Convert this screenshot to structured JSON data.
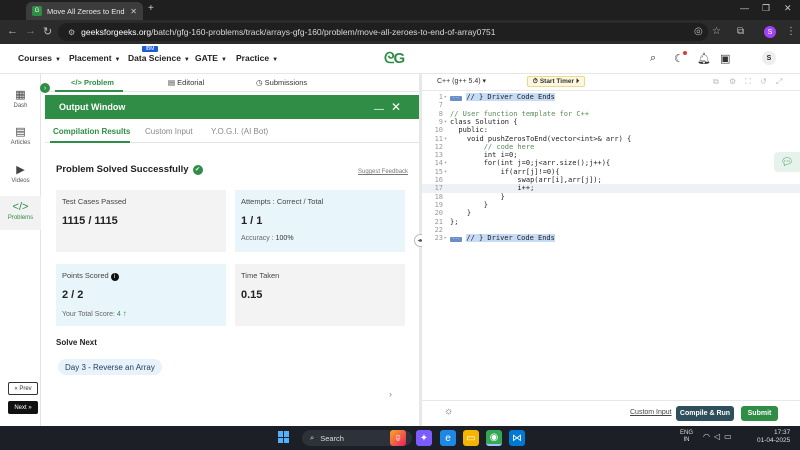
{
  "browser": {
    "tab_title": "Move All Zeroes to End | Practi",
    "tab_close": "✕",
    "new_tab": "+",
    "url_host": "geeksforgeeks.org",
    "url_path": "/batch/gfg-160-problems/track/arrays-gfg-160/problem/move-all-zeroes-to-end-of-array0751",
    "profile_initial": "S"
  },
  "header": {
    "menus": [
      "Courses",
      "Placement",
      "Data Science",
      "GATE",
      "Practice"
    ],
    "ibm_badge": "IBM",
    "avatar_initial": "S"
  },
  "sidebar": {
    "items": [
      {
        "label": "Dash",
        "icon": "grid-icon"
      },
      {
        "label": "Articles",
        "icon": "book-icon"
      },
      {
        "label": "Videos",
        "icon": "play-icon"
      },
      {
        "label": "Problems",
        "icon": "code-icon"
      }
    ],
    "prev": "« Prev",
    "next": "Next »"
  },
  "problem_tabs": {
    "problem": "Problem",
    "editorial": "Editorial",
    "submissions": "Submissions"
  },
  "output": {
    "title": "Output Window",
    "tabs": [
      "Compilation Results",
      "Custom Input",
      "Y.O.G.I. (AI Bot)"
    ],
    "status": "Problem Solved Successfully",
    "feedback": "Suggest Feedback",
    "cards": {
      "tests_label": "Test Cases Passed",
      "tests_value": "1115 / 1115",
      "attempts_label": "Attempts : Correct / Total",
      "attempts_value": "1 / 1",
      "accuracy_label": "Accuracy :",
      "accuracy_value": "100%",
      "points_label": "Points Scored",
      "points_value": "2 / 2",
      "total_score_label": "Your Total Score:",
      "total_score_value": "4",
      "time_label": "Time Taken",
      "time_value": "0.15"
    },
    "solve_next": "Solve Next",
    "next_problem": "Day 3 - Reverse an Array"
  },
  "editor": {
    "language": "C++ (g++ 5.4)",
    "timer": "Start Timer",
    "custom_input": "Custom Input",
    "compile": "Compile & Run",
    "submit": "Submit",
    "lines": [
      {
        "n": "1",
        "fold": "▸",
        "text": "// } Driver Code Ends",
        "kind": "badge"
      },
      {
        "n": "7",
        "fold": "",
        "text": "",
        "kind": "plain"
      },
      {
        "n": "8",
        "fold": "",
        "text": "// User function template for C++",
        "kind": "comment"
      },
      {
        "n": "9",
        "fold": "▾",
        "text": "class Solution {",
        "kind": "plain"
      },
      {
        "n": "10",
        "fold": "",
        "text": "  public:",
        "kind": "plain"
      },
      {
        "n": "11",
        "fold": "▾",
        "text": "    void pushZerosToEnd(vector<int>& arr) {",
        "kind": "plain"
      },
      {
        "n": "12",
        "fold": "",
        "text": "        // code here",
        "kind": "comment"
      },
      {
        "n": "13",
        "fold": "",
        "text": "        int i=0;",
        "kind": "plain"
      },
      {
        "n": "14",
        "fold": "▾",
        "text": "        for(int j=0;j<arr.size();j++){",
        "kind": "plain"
      },
      {
        "n": "15",
        "fold": "▾",
        "text": "            if(arr[j]!=0){",
        "kind": "plain"
      },
      {
        "n": "16",
        "fold": "",
        "text": "                swap(arr[i],arr[j]);",
        "kind": "plain"
      },
      {
        "n": "17",
        "fold": "",
        "text": "                i++;",
        "kind": "plain"
      },
      {
        "n": "18",
        "fold": "",
        "text": "            }",
        "kind": "plain"
      },
      {
        "n": "19",
        "fold": "",
        "text": "        }",
        "kind": "plain"
      },
      {
        "n": "20",
        "fold": "",
        "text": "    }",
        "kind": "plain"
      },
      {
        "n": "21",
        "fold": "",
        "text": "};",
        "kind": "plain"
      },
      {
        "n": "22",
        "fold": "",
        "text": "",
        "kind": "plain"
      },
      {
        "n": "23",
        "fold": "▸",
        "text": "// } Driver Code Ends",
        "kind": "badge"
      }
    ],
    "current_line_index": 11
  },
  "taskbar": {
    "search": "Search",
    "lang_top": "ENG",
    "lang_bottom": "IN",
    "time": "17:37",
    "date": "01-04-2025"
  },
  "colors": {
    "brand": "#2f8d46",
    "compile_button": "#2f4f5c",
    "info_card": "#e8f6fb",
    "neutral_card": "#f3f3f3"
  }
}
